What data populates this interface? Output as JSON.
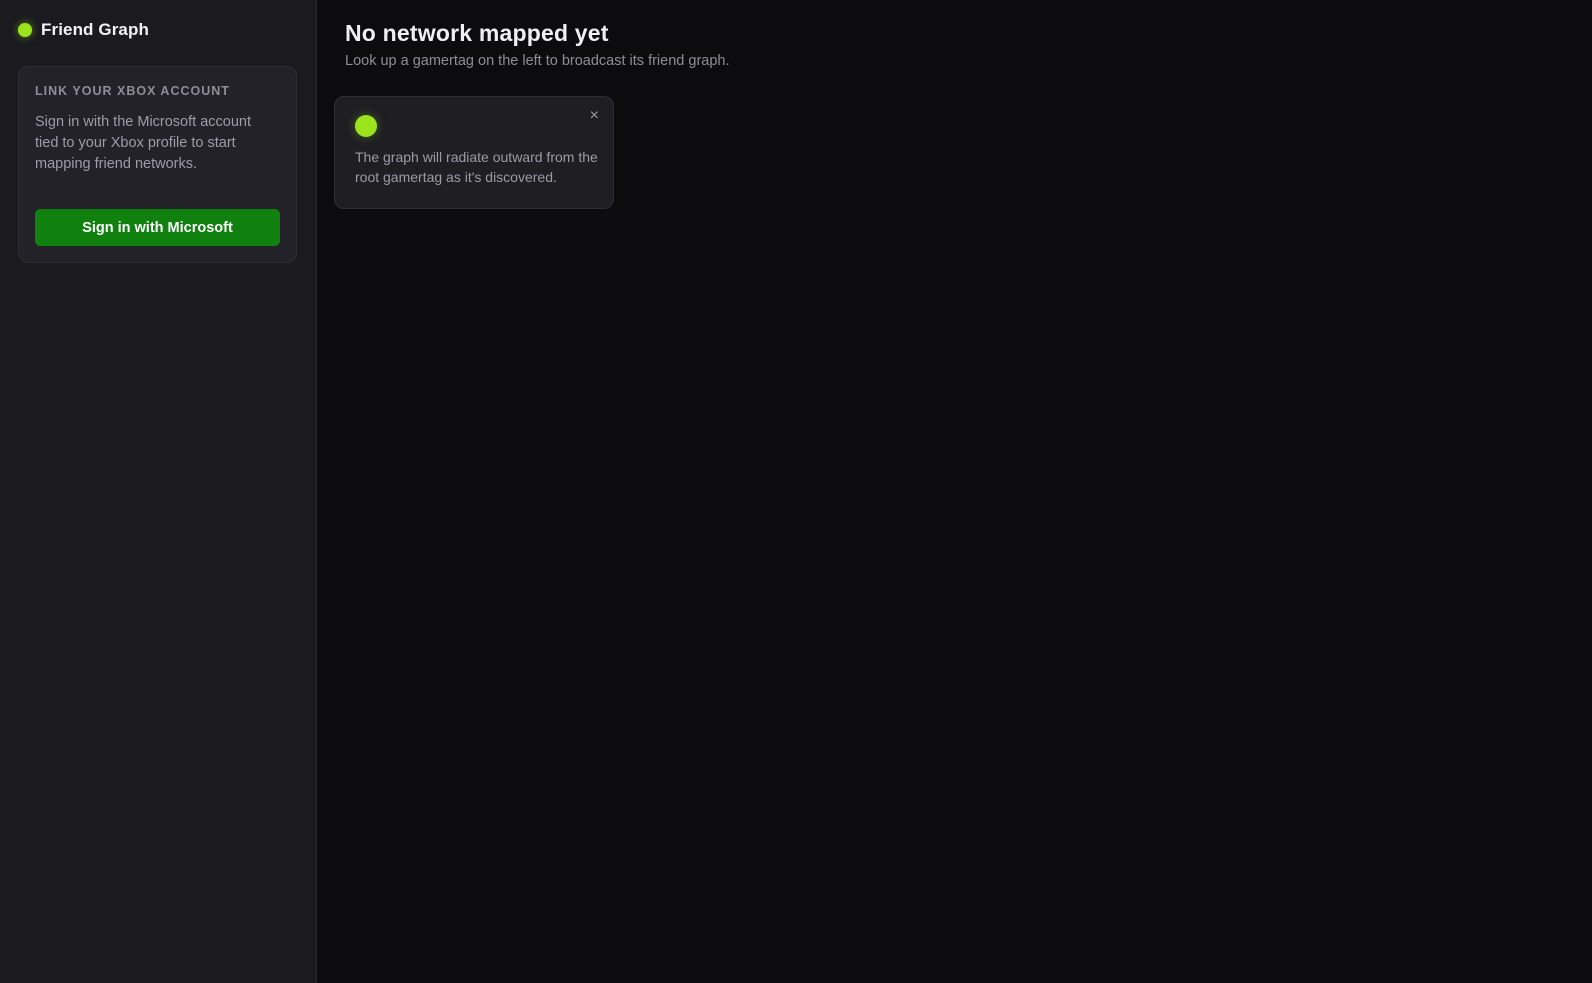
{
  "app": {
    "title": "Friend Graph",
    "accent_color": "#9be31a"
  },
  "sidebar": {
    "card": {
      "heading": "LINK YOUR XBOX ACCOUNT",
      "description": "Sign in with the Microsoft account tied to your Xbox profile to start mapping friend networks.",
      "button_label": "Sign in with Microsoft",
      "button_color": "#10800f"
    }
  },
  "main": {
    "title": "No network mapped yet",
    "subtitle": "Look up a gamertag on the left to broadcast its friend graph.",
    "toast": {
      "close_glyph": "×",
      "message": "The graph will radiate outward from the root gamertag as it's discovered."
    }
  }
}
